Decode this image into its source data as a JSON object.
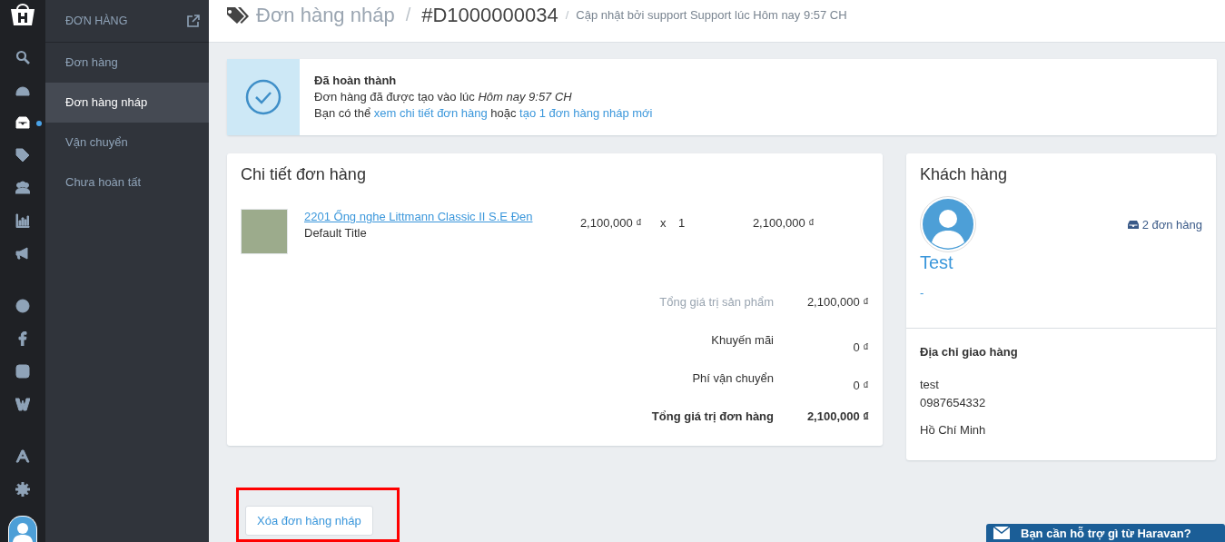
{
  "rail": {
    "items": [
      {
        "selected": false
      },
      {
        "selected": false
      },
      {
        "selected": true,
        "badge": true
      },
      {
        "selected": false
      },
      {
        "selected": false
      },
      {
        "selected": false
      },
      {
        "selected": false
      },
      {
        "selected": false
      },
      {
        "selected": false
      },
      {
        "selected": false
      },
      {
        "selected": false
      },
      {
        "selected": false
      },
      {
        "selected": false
      }
    ]
  },
  "submenu": {
    "title": "ĐƠN HÀNG",
    "items": [
      {
        "label": "Đơn hàng",
        "selected": false
      },
      {
        "label": "Đơn hàng nháp",
        "selected": true
      },
      {
        "label": "Vận chuyển",
        "selected": false
      },
      {
        "label": "Chưa hoàn tất",
        "selected": false
      }
    ]
  },
  "header": {
    "section": "Đơn hàng nháp",
    "separator_1": "/",
    "order_id": "#D1000000034",
    "separator_2": "/",
    "updated": "Cập nhật bởi support Support lúc Hôm nay 9:57 CH"
  },
  "alert": {
    "title": "Đã hoàn thành",
    "line_1": "Đơn hàng đã được tạo vào lúc *Hôm nay 9:57 CH*",
    "line_2": {
      "prefix": "Bạn có thể",
      "link_1": "xem chi tiết đơn hàng",
      "middle": "hoặc",
      "link_2": "tạo 1 đơn hàng nháp mới"
    }
  },
  "order": {
    "title": "Chi tiết đơn hàng",
    "items": [
      {
        "name": "2201 Ống nghe Littmann Classic II S.E Đen",
        "variant": "Default Title",
        "price": "2,100,000 ₫",
        "times": "x",
        "quantity": "1",
        "total": "2,100,000 ₫"
      }
    ],
    "summary": [
      {
        "label": "Tổng giá trị sản phẩm",
        "value": "2,100,000 ₫",
        "kind": "muted"
      },
      {
        "label": "Khuyến mãi",
        "value": "0 ₫",
        "kind": "normal"
      },
      {
        "label": "Phí vận chuyển",
        "value": "0 ₫",
        "kind": "normal"
      },
      {
        "label": "Tổng giá trị đơn hàng",
        "value": "2,100,000 ₫",
        "kind": "total"
      }
    ]
  },
  "customer": {
    "title": "Khách hàng",
    "orders": "2 đơn hàng",
    "name": "Test",
    "email": "-",
    "address_title": "Địa chỉ giao hàng",
    "address_lines": [
      "test",
      "0987654332"
    ],
    "city": "Hồ Chí Minh"
  },
  "delete_button": "Xóa đơn hàng nháp",
  "highlight": true,
  "support_widget": "Bạn cần hỗ trợ gì từ Haravan?"
}
